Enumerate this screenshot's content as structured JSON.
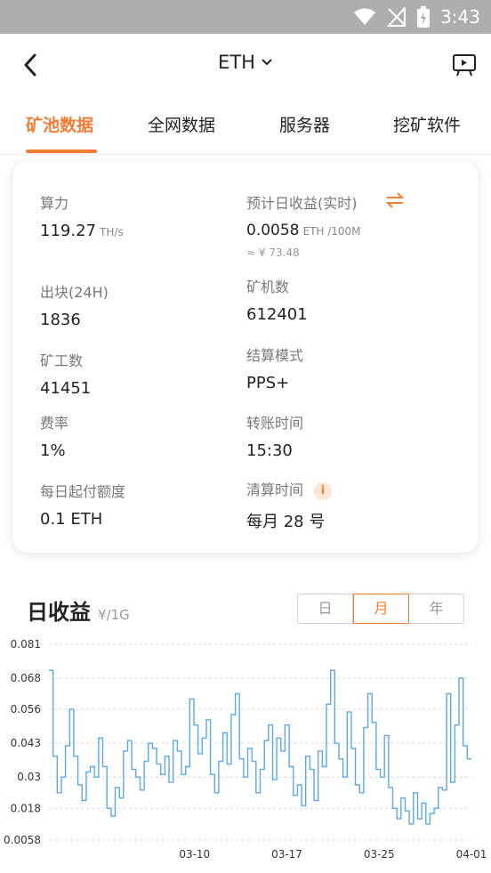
{
  "status": {
    "time": "3:43"
  },
  "nav": {
    "title": "ETH"
  },
  "tabs": [
    {
      "label": "矿池数据",
      "active": true
    },
    {
      "label": "全网数据",
      "active": false
    },
    {
      "label": "服务器",
      "active": false
    },
    {
      "label": "挖矿软件",
      "active": false
    }
  ],
  "stats": {
    "hashrate": {
      "label": "算力",
      "value": "119.27",
      "unit": "TH/s"
    },
    "est_daily": {
      "label": "预计日收益(实时)",
      "value": "0.0058",
      "unit": "ETH /100M",
      "approx": "≈ ¥ 73.48"
    },
    "blocks": {
      "label": "出块(24H)",
      "value": "1836"
    },
    "miners": {
      "label": "矿机数",
      "value": "612401"
    },
    "workers": {
      "label": "矿工数",
      "value": "41451"
    },
    "settle_mode": {
      "label": "结算模式",
      "value": "PPS+"
    },
    "fee": {
      "label": "费率",
      "value": "1%"
    },
    "transfer_time": {
      "label": "转账时间",
      "value": "15:30"
    },
    "min_payout": {
      "label": "每日起付额度",
      "value": "0.1 ETH"
    },
    "clear_time": {
      "label": "清算时间",
      "value": "每月 28 号"
    }
  },
  "section": {
    "title": "日收益",
    "unit": "¥/1G"
  },
  "period": {
    "options": [
      "日",
      "月",
      "年"
    ],
    "selected": "月"
  },
  "colors": {
    "accent": "#f07d33",
    "line": "#5ea8e6"
  },
  "chart_data": {
    "type": "line",
    "title": "",
    "xlabel": "",
    "ylabel": "",
    "ylim": [
      0.0058,
      0.081
    ],
    "y_ticks": [
      "0.081",
      "0.068",
      "0.056",
      "0.043",
      "0.03",
      "0.018",
      "0.0058"
    ],
    "x_ticks": [
      "03-10",
      "03-17",
      "03-25",
      "04-01"
    ],
    "grid": true,
    "step": true,
    "values": [
      0.071,
      0.038,
      0.024,
      0.03,
      0.042,
      0.056,
      0.038,
      0.027,
      0.021,
      0.032,
      0.034,
      0.03,
      0.045,
      0.034,
      0.018,
      0.015,
      0.026,
      0.022,
      0.04,
      0.044,
      0.033,
      0.03,
      0.025,
      0.036,
      0.043,
      0.041,
      0.035,
      0.031,
      0.038,
      0.028,
      0.044,
      0.04,
      0.031,
      0.034,
      0.06,
      0.05,
      0.039,
      0.045,
      0.052,
      0.031,
      0.024,
      0.036,
      0.047,
      0.035,
      0.054,
      0.062,
      0.037,
      0.03,
      0.041,
      0.036,
      0.024,
      0.033,
      0.044,
      0.05,
      0.029,
      0.045,
      0.04,
      0.05,
      0.034,
      0.023,
      0.027,
      0.019,
      0.038,
      0.033,
      0.021,
      0.04,
      0.034,
      0.058,
      0.071,
      0.043,
      0.037,
      0.03,
      0.055,
      0.041,
      0.027,
      0.024,
      0.049,
      0.062,
      0.051,
      0.033,
      0.03,
      0.046,
      0.026,
      0.018,
      0.014,
      0.022,
      0.017,
      0.012,
      0.024,
      0.014,
      0.02,
      0.012,
      0.016,
      0.018,
      0.026,
      0.025,
      0.062,
      0.028,
      0.05,
      0.068,
      0.042,
      0.037
    ]
  }
}
